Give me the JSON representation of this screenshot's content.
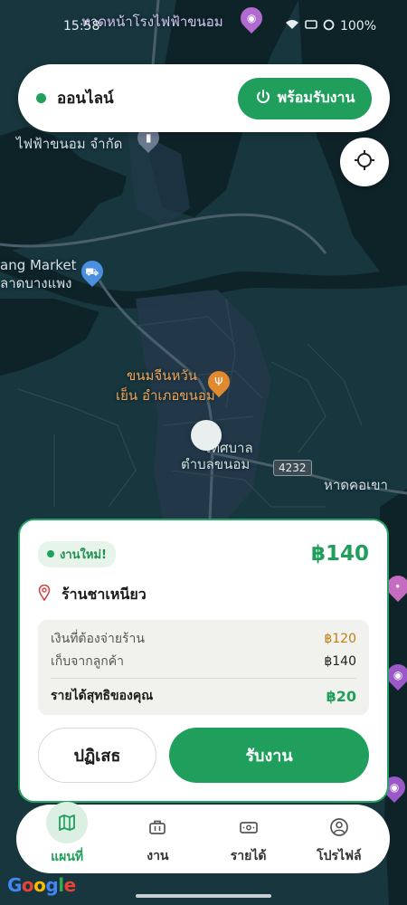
{
  "status_bar": {
    "time": "15:58",
    "battery": "100%"
  },
  "map": {
    "labels": {
      "top_poi": "หาดหน้าโรงไฟฟ้าขนอม",
      "power_company": "ไฟฟ้าขนอม จำกัด",
      "market_en": "ang Market",
      "market_th": "ลาดบางแพง",
      "restaurant_line1": "ขนมจีนหวัน",
      "restaurant_line2": "เย็น อำเภอขนอม",
      "town_line1": "เทศบาล",
      "town_line2": "ตำบลขนอม",
      "road_number": "4232",
      "beach_right": "หาดคอเขา"
    }
  },
  "top_bar": {
    "status_label": "ออนไลน์",
    "ready_button_label": "พร้อมรับงาน"
  },
  "job_offer": {
    "badge": "งานใหม่!",
    "price": "฿140",
    "shop_name": "ร้านชาเหนียว",
    "breakdown": {
      "pay_shop_label": "เงินที่ต้องจ่ายร้าน",
      "pay_shop_value": "฿120",
      "collect_label": "เก็บจากลูกค้า",
      "collect_value": "฿140",
      "net_label": "รายได้สุทธิของคุณ",
      "net_value": "฿20"
    },
    "reject_label": "ปฏิเสธ",
    "accept_label": "รับงาน"
  },
  "bottom_nav": {
    "items": [
      {
        "label": "แผนที่",
        "icon": "map-icon",
        "active": true
      },
      {
        "label": "งาน",
        "icon": "briefcase-icon",
        "active": false
      },
      {
        "label": "รายได้",
        "icon": "cash-icon",
        "active": false
      },
      {
        "label": "โปรไฟล์",
        "icon": "profile-icon",
        "active": false
      }
    ]
  },
  "attribution": "Google",
  "colors": {
    "accent_green": "#1f9e5c",
    "map_background": "#17363d",
    "water": "#0e2328",
    "price_orange": "#c07d10"
  }
}
